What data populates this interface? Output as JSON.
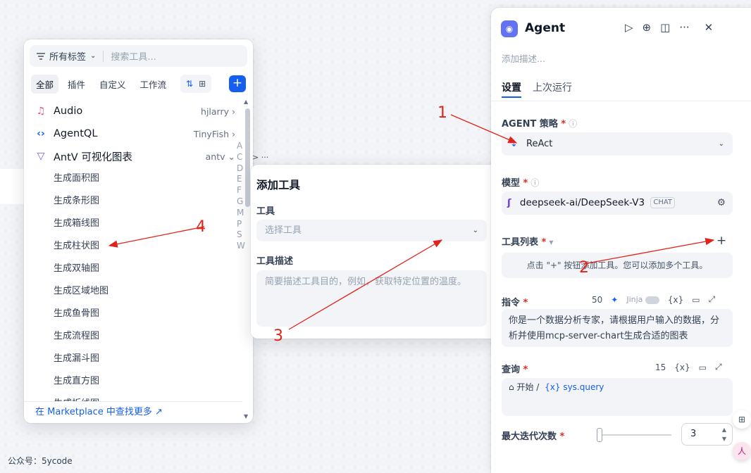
{
  "picker": {
    "filter_label": "所有标签",
    "search_placeholder": "搜索工具...",
    "tabs": [
      "全部",
      "插件",
      "自定义",
      "工作流"
    ],
    "providers": [
      {
        "name": "Audio",
        "author": "hjlarry",
        "icon": "audio-icon",
        "chevron": "›"
      },
      {
        "name": "AgentQL",
        "author": "TinyFish",
        "icon": "agentql-icon",
        "chevron": "›"
      },
      {
        "name": "AntV 可视化图表",
        "author": "antv",
        "icon": "antv-icon",
        "chevron": "⌄"
      }
    ],
    "tools": [
      "生成面积图",
      "生成条形图",
      "生成箱线图",
      "生成柱状图",
      "生成双轴图",
      "生成区域地图",
      "生成鱼骨图",
      "生成流程图",
      "生成漏斗图",
      "生成直方图",
      "生成折线图"
    ],
    "alpha_index": [
      "A",
      "C",
      "D",
      "E",
      "F",
      "G",
      "M",
      "P",
      "S",
      "W"
    ],
    "footer_link": "在 Marketplace 中查找更多 ↗"
  },
  "add_tool": {
    "title": "添加工具",
    "tool_label": "工具",
    "tool_placeholder": "选择工具",
    "desc_label": "工具描述",
    "desc_placeholder": "简要描述工具目的，例如，获取特定位置的温度。"
  },
  "agent_panel": {
    "title": "Agent",
    "description_placeholder": "添加描述...",
    "tabs": [
      "设置",
      "上次运行"
    ],
    "strategy_label": "AGENT 策略",
    "strategy_value": "ReAct",
    "model_label": "模型",
    "model_value": "deepseek-ai/DeepSeek-V3",
    "model_badge": "CHAT",
    "tools_label": "工具列表",
    "tools_hint": "点击 \"+\" 按钮添加工具。您可以添加多个工具。",
    "instruction_label": "指令",
    "instruction_count": "50",
    "jinja_label": "Jinja",
    "instruction_text": "你是一个数据分析专家，请根据用户输入的数据，分析并使用mcp-server-chart生成合适的图表",
    "query_label": "查询",
    "query_count": "15",
    "query_chip": "开始",
    "query_var": "{x} sys.query",
    "max_iter_label": "最大迭代次数",
    "max_iter_value": "3",
    "var_icon": "{x}"
  },
  "annotations": [
    "1",
    "2",
    "3",
    "4"
  ],
  "watermark": "公众号：5ycode",
  "colors": {
    "accent": "#155eef",
    "annotation": "#e2231a",
    "agent_icon": "#6172f3"
  }
}
